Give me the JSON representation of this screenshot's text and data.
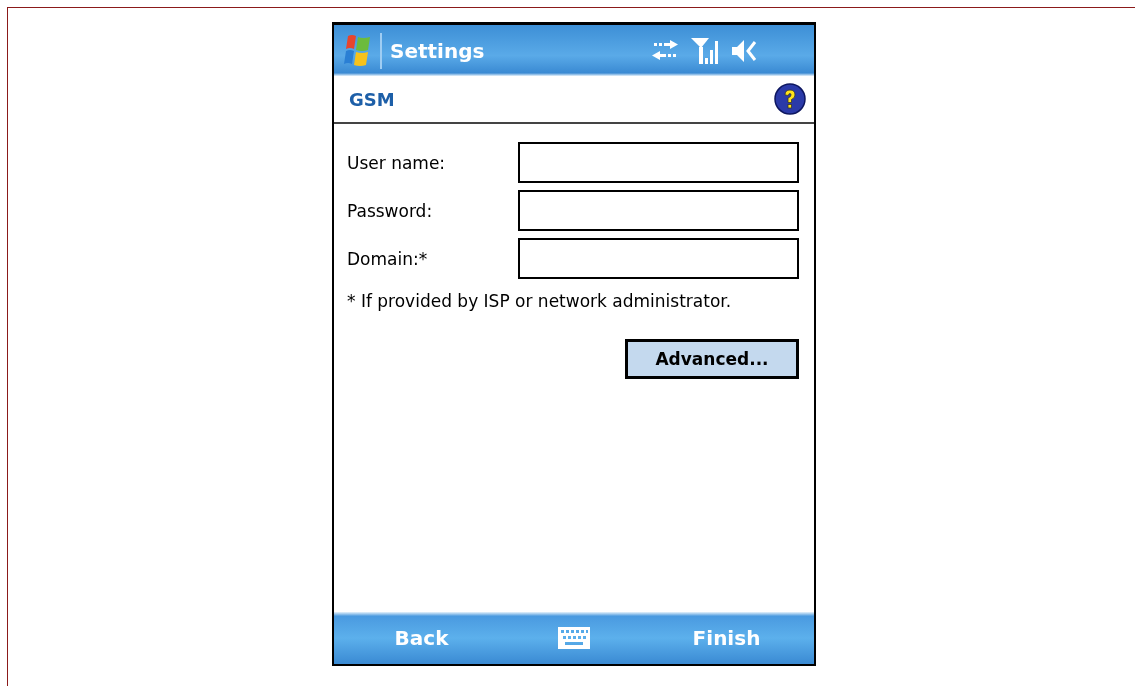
{
  "title_bar": {
    "title": "Settings"
  },
  "header": {
    "title": "GSM"
  },
  "form": {
    "fields": [
      {
        "label": "User name:"
      },
      {
        "label": "Password:"
      },
      {
        "label": "Domain:*"
      }
    ],
    "note": "* If provided by ISP or network administrator.",
    "advanced_button": "Advanced..."
  },
  "soft_keys": {
    "left": "Back",
    "right": "Finish"
  }
}
